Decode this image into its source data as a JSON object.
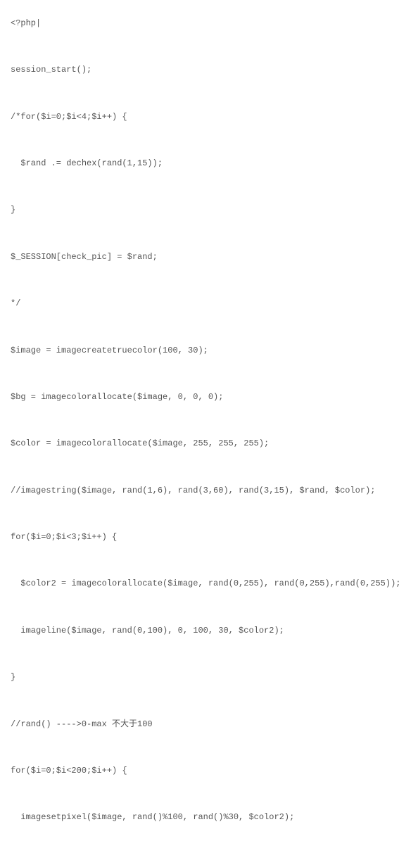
{
  "code": {
    "lines": [
      "<?php|",
      "",
      "session_start();",
      "",
      "/*for($i=0;$i<4;$i++) {",
      "",
      "  $rand .= dechex(rand(1,15));",
      "",
      "}",
      "",
      "$_SESSION[check_pic] = $rand;",
      "",
      "*/",
      "",
      "$image = imagecreatetruecolor(100, 30);",
      "",
      "$bg = imagecolorallocate($image, 0, 0, 0);",
      "",
      "$color = imagecolorallocate($image, 255, 255, 255);",
      "",
      "//imagestring($image, rand(1,6), rand(3,60), rand(3,15), $rand, $color);",
      "",
      "for($i=0;$i<3;$i++) {",
      "",
      "  $color2 = imagecolorallocate($image, rand(0,255), rand(0,255),rand(0,255));",
      "",
      "  imageline($image, rand(0,100), 0, 100, 30, $color2);",
      "",
      "}",
      "",
      "//rand() ---->0-max 不大于100",
      "",
      "for($i=0;$i<200;$i++) {",
      "",
      "  imagesetpixel($image, rand()%100, rand()%30, $color2);"
    ]
  }
}
